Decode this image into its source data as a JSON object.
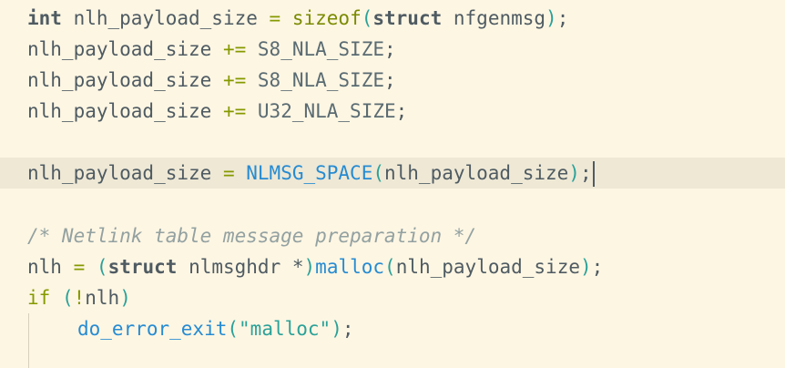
{
  "code": {
    "l1": {
      "type": "int",
      "name": "nlh_payload_size",
      "eq": "=",
      "fn": "sizeof",
      "lp": "(",
      "struct_kw": "struct",
      "arg": "nfgenmsg",
      "rp": ")",
      "semi": ";"
    },
    "l2": {
      "name": "nlh_payload_size",
      "op": "+=",
      "val": "S8_NLA_SIZE",
      "semi": ";"
    },
    "l3": {
      "name": "nlh_payload_size",
      "op": "+=",
      "val": "S8_NLA_SIZE",
      "semi": ";"
    },
    "l4": {
      "name": "nlh_payload_size",
      "op": "+=",
      "val": "U32_NLA_SIZE",
      "semi": ";"
    },
    "l6": {
      "name": "nlh_payload_size",
      "eq": "=",
      "macro": "NLMSG_SPACE",
      "lp": "(",
      "arg": "nlh_payload_size",
      "rp": ")",
      "semi": ";"
    },
    "l8": {
      "comment": "/* Netlink table message preparation */"
    },
    "l9": {
      "name": "nlh",
      "eq": "=",
      "lp1": "(",
      "struct_kw": "struct",
      "type": "nlmsghdr *",
      "rp1": ")",
      "call": "malloc",
      "lp2": "(",
      "arg": "nlh_payload_size",
      "rp2": ")",
      "semi": ";"
    },
    "l10": {
      "kw": "if",
      "lp": "(",
      "op": "!",
      "name": "nlh",
      "rp": ")"
    },
    "l11": {
      "call": "do_error_exit",
      "lp": "(",
      "str": "\"malloc\"",
      "rp": ")",
      "semi": ";"
    }
  }
}
